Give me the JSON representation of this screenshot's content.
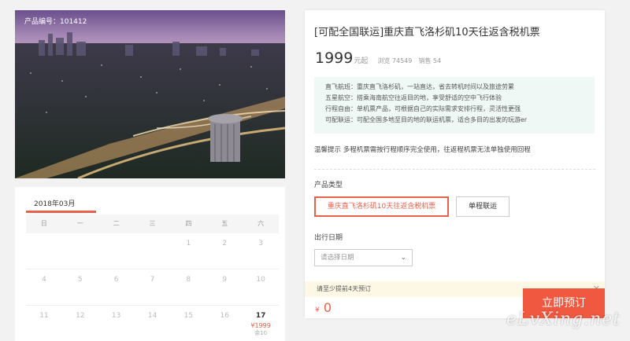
{
  "product": {
    "product_no": "产品编号：101412",
    "title": "[可配全国联运]重庆直飞洛杉矶10天往返含税机票",
    "price": "1999",
    "price_unit": "元起",
    "views": "浏览 74549",
    "sales": "销售 54"
  },
  "features": [
    "直飞航班：重庆直飞洛杉矶，一站直达，省去转机时间以及旅途劳累",
    "五星航空：搭乘海南航空往返目的地，享受舒适的空中飞行体验",
    "行程自由：单机票产品，可根据自己的实际需求安排行程，灵活性更强",
    "可配联运：可配全国多地至目的地的联运机票，适合多目的出发的玩游er"
  ],
  "tip": "温馨提示   多程机票需按行程顺序完全使用，往返程机票无法单独使用回程",
  "product_type": {
    "label": "产品类型",
    "options": [
      "重庆直飞洛杉矶10天往返含税机票",
      "单程联运"
    ]
  },
  "departure": {
    "label": "出行日期",
    "placeholder": "请选择日期"
  },
  "notice": "请至少提前4天预订",
  "total": {
    "currency": "¥",
    "amount": "0"
  },
  "book_button": "立即预订",
  "calendar": {
    "month": "2018年03月",
    "weekdays": [
      "日",
      "一",
      "二",
      "三",
      "四",
      "五",
      "六"
    ],
    "rows": [
      [
        "",
        "",
        "",
        "",
        "1",
        "2",
        "3"
      ],
      [
        "4",
        "5",
        "6",
        "7",
        "8",
        "9",
        "10"
      ],
      [
        "11",
        "12",
        "13",
        "14",
        "15",
        "16",
        "17"
      ]
    ],
    "highlight": {
      "day": "17",
      "price": "¥1999",
      "stock": "余10"
    }
  },
  "watermark": "eLvXing.net",
  "colors": {
    "accent": "#f0583f",
    "feature_bg": "#f0f8f5",
    "notice_bg": "#fdf8e6"
  }
}
